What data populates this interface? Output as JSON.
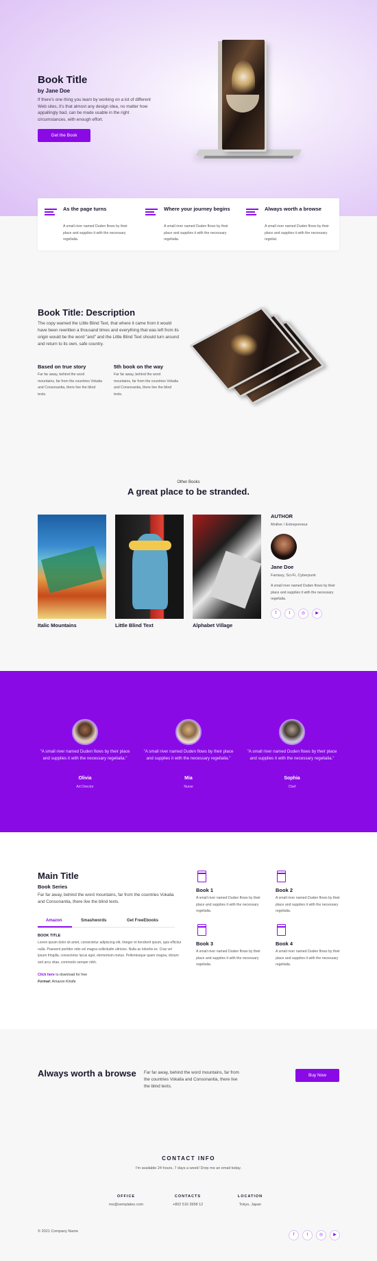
{
  "hero": {
    "title": "Book Title",
    "author": "by Jane Doe",
    "text": "If there's one thing you learn by working on a lot of different Web sites, it's that almost any design idea, no matter how appallingly bad, can be made usable in the right circumstances, with enough effort.",
    "button": "Get the Book"
  },
  "features": [
    {
      "title": "As the page turns",
      "text": "A small river named Duden flows by their place and supplies it with the necessary regelialia.",
      "icon": "lines-icon"
    },
    {
      "title": "Where your journey begins",
      "text": "A small river named Duden flows by their place and supplies it with the necessary regelialia.",
      "icon": "lines-icon"
    },
    {
      "title": "Always worth a browse",
      "text": "A small river named Duden flows by their place and supplies it with the necessary regelial.",
      "icon": "lines-icon"
    }
  ],
  "description": {
    "title": "Book Title: Description",
    "text": "The copy warned the Little Blind Text, that where it came from it would have been rewritten a thousand times and everything that was left from its origin would be the word \"and\" and the Little Blind Text should turn around and return to its own, safe country.",
    "cols": [
      {
        "title": "Based on true story",
        "text": "Far far away, behind the word mountains, far from the countries Vokalia and Consonantia, there live the blind texts."
      },
      {
        "title": "5th book on the way",
        "text": "Far far away, behind the word mountains, far from the countries Vokalia and Consonantia, there live the blind texts."
      }
    ]
  },
  "other_books": {
    "kicker": "Other Books",
    "title": "A great place to be stranded.",
    "books": [
      {
        "title": "Italic Mountains"
      },
      {
        "title": "Little Blind Text"
      },
      {
        "title": "Alphabet Village"
      }
    ],
    "author": {
      "heading": "AUTHOR",
      "role": "Mother / Entrepreneur",
      "name": "Jane Doe",
      "place": "Fantasy, Sci-Fi, Cyberpunk",
      "bio": "A small river named Duden flows by their place and supplies it with the necessary regelialia.",
      "social": [
        "facebook-icon",
        "twitter-icon",
        "instagram-icon",
        "youtube-icon"
      ],
      "social_glyphs": [
        "f",
        "t",
        "◎",
        "▶"
      ]
    }
  },
  "testimonials": [
    {
      "quote": "\"A small river named Duden flows by their place and supplies it with the necessary regelialia.\"",
      "name": "Olivia",
      "role": "Art Director"
    },
    {
      "quote": "\"A small river named Duden flows by their place and supplies it with the necessary regelialia.\"",
      "name": "Mia",
      "role": "Nurse"
    },
    {
      "quote": "\"A small river named Duden flows by their place and supplies it with the necessary regelialia.\"",
      "name": "Sophia",
      "role": "Chef"
    }
  ],
  "main": {
    "title": "Main Title",
    "subtitle": "Book Series",
    "text": "Far far away, behind the word mountains, far from the countries Vokalia and Consonantia, there live the blind texts.",
    "tabs": [
      "Amazon",
      "Smashwords",
      "Get FreeEbooks"
    ],
    "book_title": "BOOK TITLE",
    "lorem": "Lorem ipsum dolor sit amet, consectetur adipiscing elit. Integer et hendrerit ipsum, quis efficitur nulla. Praesent porttitor odio vel magna sollicitudin ultricies. Nulla ac lobortis ex. Cras vel ipsum fringilla, consectetur lacus eget, elementum metus. Pellentesque quam magna, dictum sed arcu vitae, commodo semper nibh.",
    "click_here": "Click here",
    "download": " to download for free",
    "format_label": "Format:",
    "format_value": " Amazon Kindle",
    "books": [
      {
        "title": "Book 1",
        "text": "A small river named Duden flows by their place and supplies it with the necessary regelialia."
      },
      {
        "title": "Book 2",
        "text": "A small river named Duden flows by their place and supplies it with the necessary regelialia."
      },
      {
        "title": "Book 3",
        "text": "A small river named Duden flows by their place and supplies it with the necessary regelialia."
      },
      {
        "title": "Book 4",
        "text": "A small river named Duden flows by their place and supplies it with the necessary regelialia."
      }
    ]
  },
  "cta": {
    "title": "Always worth a browse",
    "text": "Far far away, behind the word mountains, far from the countries Vokalia and Consonantia, there live the blind texts.",
    "button": "Buy Now"
  },
  "footer": {
    "contact_title": "CONTACT INFO",
    "contact_sub": "I'm available 24 hours, 7 days a week! Drop me an email today.",
    "cols": [
      {
        "heading": "OFFICE",
        "value": "me@semplates.com"
      },
      {
        "heading": "CONTACTS",
        "value": "+802 516 3958 12"
      },
      {
        "heading": "LOCATION",
        "value": "Tokyo, Japan"
      }
    ],
    "copyright": "© 2021 Company Name",
    "social": [
      "facebook-icon",
      "twitter-icon",
      "instagram-icon",
      "youtube-icon"
    ],
    "social_glyphs": [
      "f",
      "t",
      "◎",
      "▶"
    ]
  },
  "colors": {
    "accent": "#8a0ae6",
    "hero_bg": "#dcc0f6",
    "testimonial_bg": "#8a0ae6"
  }
}
